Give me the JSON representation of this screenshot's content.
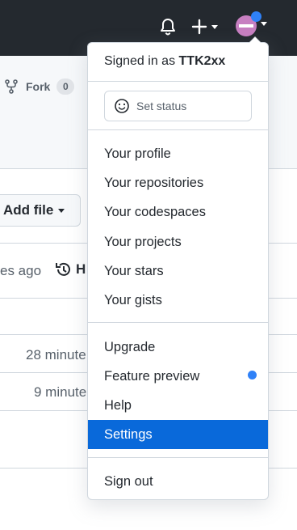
{
  "header": {
    "icons": [
      "bell-icon",
      "plus-icon",
      "avatar"
    ],
    "colors": {
      "bar": "#24292f",
      "avatar": "#c77fc1",
      "status_dot": "#2f81f7"
    }
  },
  "repo": {
    "fork_label": "Fork",
    "fork_count": "0",
    "add_file_label": "Add file",
    "last_commit_fragment": "es ago",
    "history_fragment": "H",
    "rows": [
      {
        "time": "28 minute"
      },
      {
        "time": "9 minute"
      }
    ]
  },
  "menu": {
    "signed_in_prefix": "Signed in as",
    "username": "TTK2xx",
    "set_status": "Set status",
    "group1": [
      "Your profile",
      "Your repositories",
      "Your codespaces",
      "Your projects",
      "Your stars",
      "Your gists"
    ],
    "group2": [
      "Upgrade",
      "Feature preview",
      "Help",
      "Settings"
    ],
    "sign_out": "Sign out",
    "active_item": "Settings",
    "colors": {
      "active_bg": "#0969da",
      "feature_dot": "#2f81f7"
    }
  }
}
